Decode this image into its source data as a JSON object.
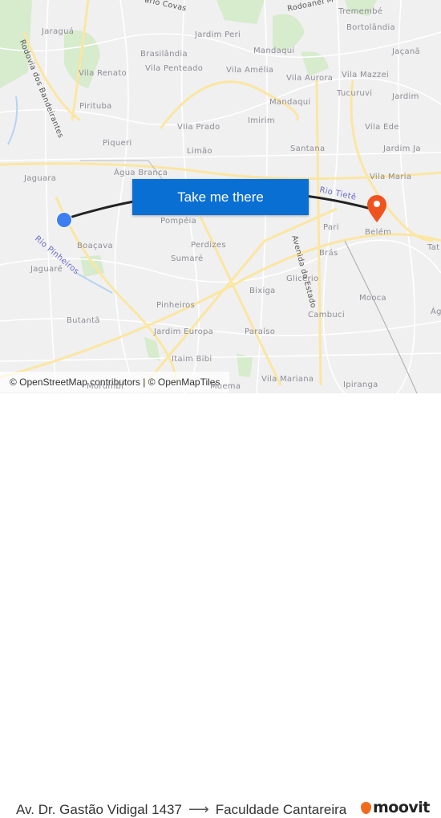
{
  "map": {
    "labels": [
      "Jaraguá",
      "Jardim Peri",
      "Brasilândia",
      "Vila Penteado",
      "Mandaqui",
      "Vila Amélia",
      "Vila Aurora",
      "Vila Mazzei",
      "Tremembé",
      "Bortolândia",
      "Jaçanã",
      "Vila Renato",
      "Tucuruvi",
      "Jardim",
      "Pirituba",
      "Mandaqui",
      "Imirim",
      "VIla Prado",
      "Vila Ede",
      "Piqueri",
      "Limão",
      "Santana",
      "Jardim Ja",
      "Jaguara",
      "Água Branca",
      "Vila Maria",
      "Pompéia",
      "Pari",
      "Belém",
      "Boaçava",
      "Perdizes",
      "Brás",
      "Tat",
      "Sumaré",
      "Jaguaré",
      "Glicério",
      "Bixiga",
      "Mooca",
      "Pinheiros",
      "Cambuci",
      "Ág",
      "Butantã",
      "Jardim Europa",
      "Paraíso",
      "Itaim Bibi",
      "Vila Mariana",
      "Ipiranga",
      "Morumbi",
      "Moema"
    ],
    "road_labels": [
      "Rodovia dos Bandeirantes",
      "ário Covas",
      "Rodoanel M",
      "Avenida do Estado"
    ],
    "river_labels": [
      "Rio Tietê",
      "Rio Pinheiros"
    ],
    "route_color": "#222222",
    "origin_color": "#3d7ff0",
    "destination_color": "#f0541e"
  },
  "cta": {
    "label": "Take me there",
    "color": "#0a6fd3"
  },
  "attribution": "© OpenStreetMap contributors | © OpenMapTiles",
  "footer": {
    "origin": "Av. Dr. Gastão Vidigal 1437",
    "arrow": "⟶",
    "destination": "Faculdade Cantareira",
    "brand": "moovit",
    "brand_color": "#f26b1d"
  }
}
